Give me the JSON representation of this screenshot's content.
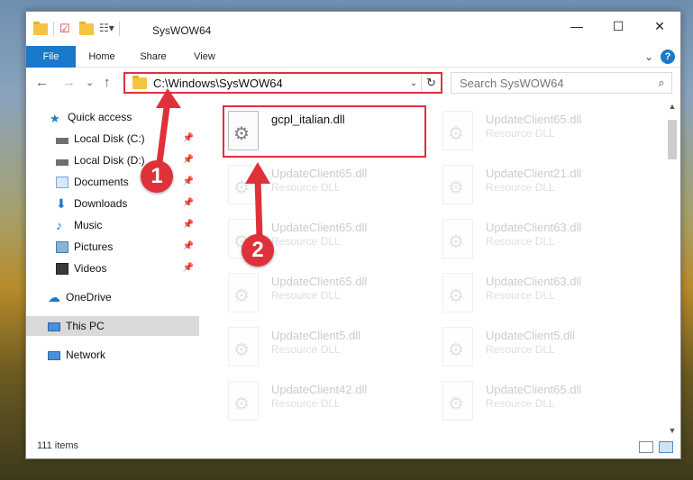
{
  "window": {
    "title": "SysWOW64",
    "controls": {
      "minimize": "—",
      "maximize": "☐",
      "close": "✕"
    }
  },
  "ribbon": {
    "tabs": [
      "File",
      "Home",
      "Share",
      "View"
    ],
    "help_label": "?",
    "expand_glyph": "⌄"
  },
  "navigation": {
    "back": "←",
    "forward": "→",
    "recent": "⌄",
    "up": "↑",
    "address": "C:\\Windows\\SysWOW64",
    "address_dropdown": "⌄",
    "refresh": "↻"
  },
  "search": {
    "placeholder": "Search SysWOW64",
    "value": "",
    "icon": "search-icon"
  },
  "sidebar": {
    "items": [
      {
        "label": "Quick access",
        "icon": "star-icon",
        "pinned": false
      },
      {
        "label": "Local Disk (C:)",
        "icon": "drive-icon",
        "pinned": true
      },
      {
        "label": "Local Disk (D:)",
        "icon": "drive-icon",
        "pinned": true
      },
      {
        "label": "Documents",
        "icon": "documents-icon",
        "pinned": true
      },
      {
        "label": "Downloads",
        "icon": "download-icon",
        "pinned": true
      },
      {
        "label": "Music",
        "icon": "music-icon",
        "pinned": true
      },
      {
        "label": "Pictures",
        "icon": "pictures-icon",
        "pinned": true
      },
      {
        "label": "Videos",
        "icon": "video-icon",
        "pinned": true
      },
      {
        "label": "OneDrive",
        "icon": "cloud-icon",
        "pinned": false
      },
      {
        "label": "This PC",
        "icon": "computer-icon",
        "pinned": false,
        "selected": true
      },
      {
        "label": "Network",
        "icon": "network-icon",
        "pinned": false
      }
    ]
  },
  "files": [
    {
      "name": "gcpl_italian.dll",
      "type": "",
      "highlighted": true
    },
    {
      "name": "UpdateClient65.dll",
      "type": "Resource DLL"
    },
    {
      "name": "UpdateClient65.dll",
      "type": "Resource DLL"
    },
    {
      "name": "UpdateClient21.dll",
      "type": "Resource DLL"
    },
    {
      "name": "UpdateClient65.dll",
      "type": "Resource DLL"
    },
    {
      "name": "UpdateClient63.dll",
      "type": "Resource DLL"
    },
    {
      "name": "UpdateClient65.dll",
      "type": "Resource DLL"
    },
    {
      "name": "UpdateClient63.dll",
      "type": "Resource DLL"
    },
    {
      "name": "UpdateClient5.dll",
      "type": "Resource DLL"
    },
    {
      "name": "UpdateClient5.dll",
      "type": "Resource DLL"
    },
    {
      "name": "UpdateClient42.dll",
      "type": "Resource DLL"
    },
    {
      "name": "UpdateClient65.dll",
      "type": "Resource DLL"
    }
  ],
  "status": {
    "item_count": "111 items"
  },
  "annotations": {
    "step1": "1",
    "step2": "2"
  },
  "colors": {
    "accent": "#1979ca",
    "highlight": "#e0313b",
    "selected": "#d9d9d9"
  }
}
